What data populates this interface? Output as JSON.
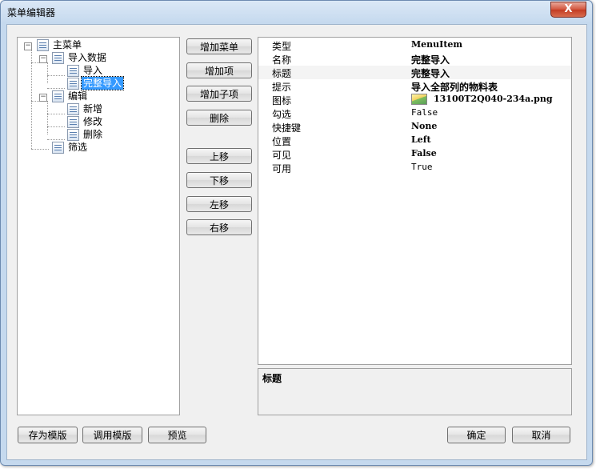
{
  "window": {
    "title": "菜单编辑器",
    "close": "X"
  },
  "tree": {
    "root": "主菜单",
    "import_group": "导入数据",
    "import": "导入",
    "full_import": "完整导入",
    "edit_group": "编辑",
    "add": "新增",
    "modify": "修改",
    "delete": "删除",
    "filter": "筛选"
  },
  "actions": {
    "add_menu": "增加菜单",
    "add_item": "增加项",
    "add_subitem": "增加子项",
    "delete": "删除",
    "move_up": "上移",
    "move_down": "下移",
    "move_left": "左移",
    "move_right": "右移"
  },
  "properties": [
    {
      "key": "类型",
      "value": "MenuItem"
    },
    {
      "key": "名称",
      "value": "完整导入"
    },
    {
      "key": "标题",
      "value": "完整导入"
    },
    {
      "key": "提示",
      "value": "导入全部列的物料表"
    },
    {
      "key": "图标",
      "value": "13100T2Q040-234a.png"
    },
    {
      "key": "勾选",
      "value": "False"
    },
    {
      "key": "快捷键",
      "value": "None"
    },
    {
      "key": "位置",
      "value": "Left"
    },
    {
      "key": "可见",
      "value": "False"
    },
    {
      "key": "可用",
      "value": "True"
    }
  ],
  "description": {
    "title": "标题"
  },
  "footer": {
    "save_template": "存为模版",
    "load_template": "调用模版",
    "preview": "预览",
    "ok": "确定",
    "cancel": "取消"
  }
}
